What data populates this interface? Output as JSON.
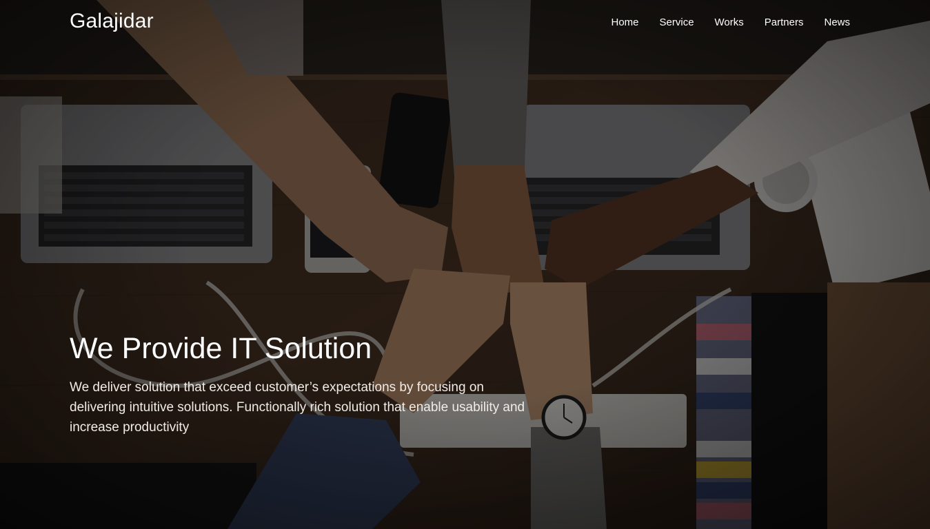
{
  "navbar": {
    "brand": "Galajidar",
    "links": [
      {
        "label": "Home"
      },
      {
        "label": "Service"
      },
      {
        "label": "Works"
      },
      {
        "label": "Partners"
      },
      {
        "label": "News"
      }
    ]
  },
  "hero": {
    "title": "We Provide IT Solution",
    "description": "We deliver solution that exceed customer’s expectations by focusing on delivering intuitive solutions. Functionally rich solution that enable usability and increase productivity",
    "background_image": "team-fist-bump-over-desk-with-laptops-photo"
  }
}
